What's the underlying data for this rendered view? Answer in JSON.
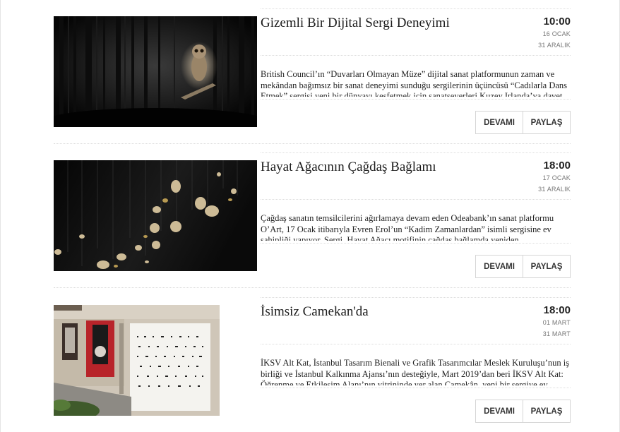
{
  "events": [
    {
      "title": "Gizemli Bir Dijital Sergi Deneyimi",
      "time": "10:00",
      "start_date": "16 OCAK",
      "end_date": "31 ARALIK",
      "description": "British Council’ın “Duvarları Olmayan Müze” dijital sanat platformunun zaman ve mekândan bağımsız bir sanat deneyimi sunduğu sergilerinin üçüncüsü “Cadılarla Dans Etmek” sergisi yeni bir dünyayı keşfetmek için sanatseverleri Kuzey Irlanda’ya davet ediyor.",
      "more_label": "DEVAMI",
      "share_label": "PAYLAŞ"
    },
    {
      "title": "Hayat Ağacının Çağdaş Bağlamı",
      "time": "18:00",
      "start_date": "17 OCAK",
      "end_date": "31 ARALIK",
      "description": "Çağdaş sanatın temsilcilerini ağırlamaya devam eden Odeabank’ın sanat platformu O’Art, 17 Ocak itibarıyla Evren Erol’un “Kadim Zamanlardan” isimli sergisine ev sahipliği yapıyor. Sergi, Hayat Ağacı motifinin çağdaş bağlamda yeniden yorumlanmasını konu alıyor.",
      "more_label": "DEVAMI",
      "share_label": "PAYLAŞ"
    },
    {
      "title": "İsimsiz Camekan'da",
      "time": "18:00",
      "start_date": "01 MART",
      "end_date": "31 MART",
      "description": "İKSV Alt Kat, İstanbul Tasarım Bienali ve Grafik Tasarımcılar Meslek Kuruluşu’nun iş birliği ve İstanbul Kalkınma Ajansı’nın desteğiyle, Mart 2019’dan beri İKSV Alt Kat: Öğrenme ve Etkileşim Alanı’nın vitrininde yer alan Camekân, yeni bir sergiye ev sahipliği yapıyor.",
      "more_label": "DEVAMI",
      "share_label": "PAYLAŞ"
    }
  ]
}
